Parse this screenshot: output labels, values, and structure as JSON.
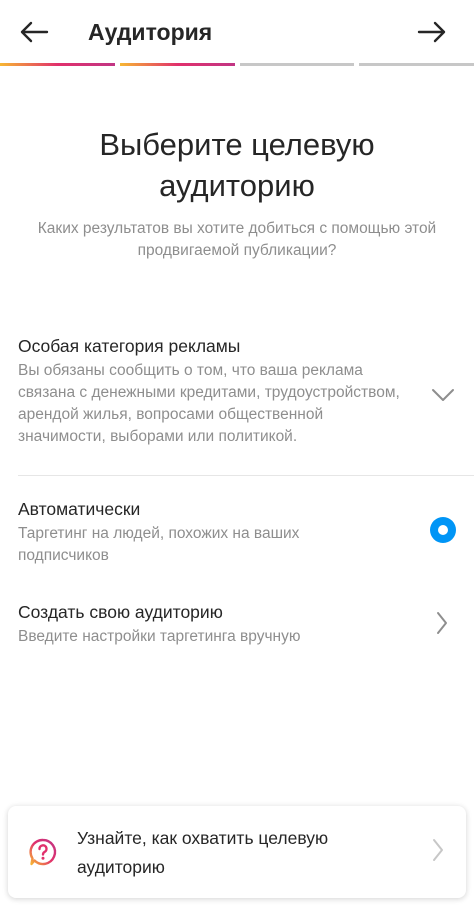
{
  "header": {
    "title": "Аудитория",
    "back_icon": "arrow-left-icon",
    "next_icon": "arrow-right-icon"
  },
  "progress": {
    "segments": 4,
    "completed": 2,
    "gradient": [
      "#f7b733",
      "#e1306c",
      "#c13584"
    ],
    "inactive_color": "#c7c7c7"
  },
  "headline": "Выберите целевую аудиторию",
  "subtitle": "Каких результатов вы хотите добиться с помощью этой продвигаемой публикации?",
  "options": {
    "special": {
      "title": "Особая категория рекламы",
      "description": "Вы обязаны сообщить о том, что ваша реклама связана с денежными кредитами, трудоустройством, арендой жилья, вопросами общественной значимости, выборами или политикой.",
      "icon": "chevron-down-icon"
    },
    "auto": {
      "title": "Автоматически",
      "description": "Таргетинг на людей, похожих на ваших подписчиков",
      "selected": true
    },
    "custom": {
      "title": "Создать свою аудиторию",
      "description": "Введите настройки таргетинга вручную",
      "icon": "chevron-right-icon"
    }
  },
  "banner": {
    "text": "Узнайте, как охватить целевую аудиторию",
    "icon": "question-bubble-icon"
  },
  "colors": {
    "accent": "#0095f6",
    "text_primary": "#262626",
    "text_secondary": "#8e8e8e"
  }
}
